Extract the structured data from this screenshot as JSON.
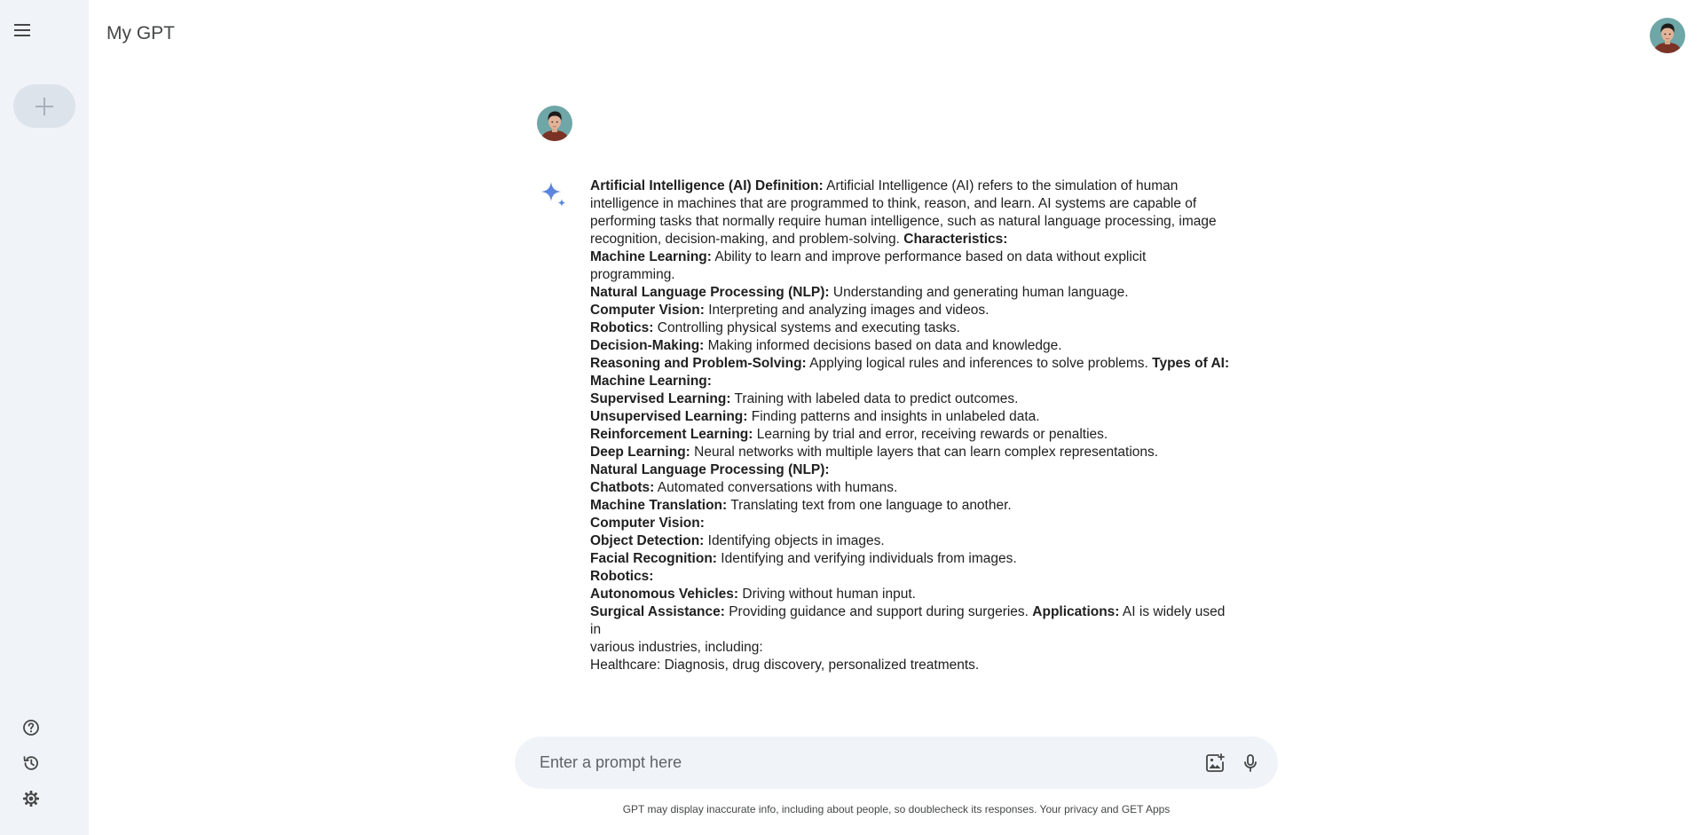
{
  "app": {
    "title": "My GPT"
  },
  "sidebar": {
    "menu_icon": "menu-icon",
    "new_chat_icon": "plus-icon",
    "bottom_icons": [
      "help-icon",
      "activity-icon",
      "settings-icon"
    ]
  },
  "colors": {
    "sidebar_bg": "#f0f4f9",
    "new_chat_bg": "#dde3ea",
    "prompt_bg": "#f0f4f9",
    "sparkle_blue": "#4b7be5"
  },
  "response": {
    "lines": [
      [
        {
          "b": "Artificial Intelligence (AI) Definition:"
        },
        {
          "t": " Artificial Intelligence (AI) refers to the simulation of human"
        }
      ],
      [
        {
          "t": "intelligence in machines that are programmed to think, reason, and learn. AI systems are capable of"
        }
      ],
      [
        {
          "t": "performing tasks that normally require human intelligence, such as natural language processing, image"
        }
      ],
      [
        {
          "t": "recognition, decision-making, and problem-solving. "
        },
        {
          "b": "Characteristics:"
        }
      ],
      [
        {
          "b": "Machine Learning:"
        },
        {
          "t": " Ability to learn and improve performance based on data without explicit"
        }
      ],
      [
        {
          "t": "programming."
        }
      ],
      [
        {
          "b": "Natural Language Processing (NLP):"
        },
        {
          "t": " Understanding and generating human language."
        }
      ],
      [
        {
          "b": "Computer Vision:"
        },
        {
          "t": " Interpreting and analyzing images and videos."
        }
      ],
      [
        {
          "b": "Robotics:"
        },
        {
          "t": " Controlling physical systems and executing tasks."
        }
      ],
      [
        {
          "b": "Decision-Making:"
        },
        {
          "t": " Making informed decisions based on data and knowledge."
        }
      ],
      [
        {
          "b": "Reasoning and Problem-Solving:"
        },
        {
          "t": " Applying logical rules and inferences to solve problems. "
        },
        {
          "b": "Types of AI:"
        }
      ],
      [
        {
          "b": "Machine Learning:"
        }
      ],
      [
        {
          "b": "Supervised Learning:"
        },
        {
          "t": " Training with labeled data to predict outcomes."
        }
      ],
      [
        {
          "b": "Unsupervised Learning:"
        },
        {
          "t": " Finding patterns and insights in unlabeled data."
        }
      ],
      [
        {
          "b": "Reinforcement Learning:"
        },
        {
          "t": " Learning by trial and error, receiving rewards or penalties."
        }
      ],
      [
        {
          "b": "Deep Learning:"
        },
        {
          "t": " Neural networks with multiple layers that can learn complex representations."
        }
      ],
      [
        {
          "b": "Natural Language Processing (NLP):"
        }
      ],
      [
        {
          "b": "Chatbots:"
        },
        {
          "t": " Automated conversations with humans."
        }
      ],
      [
        {
          "b": "Machine Translation:"
        },
        {
          "t": " Translating text from one language to another."
        }
      ],
      [
        {
          "b": "Computer Vision:"
        }
      ],
      [
        {
          "b": "Object Detection:"
        },
        {
          "t": " Identifying objects in images."
        }
      ],
      [
        {
          "b": "Facial Recognition:"
        },
        {
          "t": " Identifying and verifying individuals from images."
        }
      ],
      [
        {
          "b": "Robotics:"
        }
      ],
      [
        {
          "b": "Autonomous Vehicles:"
        },
        {
          "t": " Driving without human input."
        }
      ],
      [
        {
          "b": "Surgical Assistance:"
        },
        {
          "t": " Providing guidance and support during surgeries. "
        },
        {
          "b": "Applications:"
        },
        {
          "t": " AI is widely used in"
        }
      ],
      [
        {
          "t": "various industries, including:"
        }
      ],
      [
        {
          "t": "Healthcare: Diagnosis, drug discovery, personalized treatments."
        }
      ]
    ]
  },
  "prompt": {
    "placeholder": "Enter a prompt here",
    "value": "",
    "image_icon": "image-upload-icon",
    "mic_icon": "mic-icon"
  },
  "footer": {
    "disclaimer": "GPT may display inaccurate info, including about people, so doublecheck its responses. Your privacy and GET Apps"
  }
}
